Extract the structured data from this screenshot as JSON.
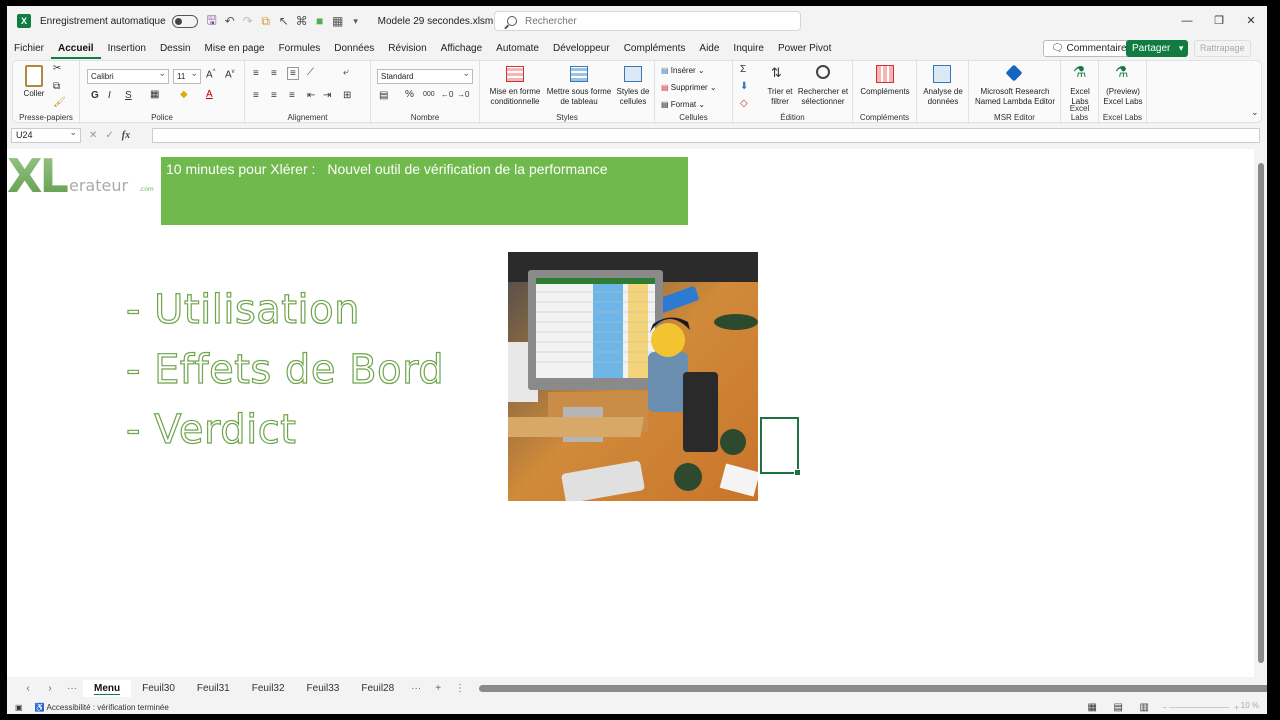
{
  "titlebar": {
    "autosave_label": "Enregistrement automatique",
    "doc_title": "Modele 29 secondes.xlsm  -  E...",
    "search_placeholder": "Rechercher"
  },
  "menu": {
    "items": [
      "Fichier",
      "Accueil",
      "Insertion",
      "Dessin",
      "Mise en page",
      "Formules",
      "Données",
      "Révision",
      "Affichage",
      "Automate",
      "Développeur",
      "Compléments",
      "Aide",
      "Inquire",
      "Power Pivot"
    ],
    "active": "Accueil",
    "comments": "Commentaires",
    "share": "Partager",
    "catchup": "Rattrapage"
  },
  "ribbon": {
    "clipboard": {
      "label": "Presse-papiers",
      "paste": "Coller"
    },
    "font": {
      "label": "Police",
      "font_name": "Calibri",
      "font_size": "11",
      "bold": "G",
      "italic": "I",
      "underline": "S"
    },
    "alignment": {
      "label": "Alignement"
    },
    "number": {
      "label": "Nombre",
      "format": "Standard",
      "percent": "%"
    },
    "styles": {
      "label": "Styles",
      "cond_format": "Mise en forme conditionnelle",
      "table_format": "Mettre sous forme de tableau",
      "cell_styles": "Styles de cellules"
    },
    "cells": {
      "label": "Cellules",
      "insert": "Insérer",
      "delete": "Supprimer",
      "format": "Format"
    },
    "editing": {
      "label": "Édition",
      "sort": "Trier et filtrer",
      "find": "Rechercher et sélectionner"
    },
    "addins": {
      "label": "Compléments",
      "addins": "Compléments",
      "analyze": "Analyse de données"
    },
    "msr": {
      "label": "MSR Editor",
      "lambda": "Microsoft Research Named Lambda Editor"
    },
    "labs": {
      "label": "Excel Labs",
      "button": "Excel Labs"
    },
    "labs_preview": {
      "label": "Excel Labs",
      "button": "(Preview) Excel Labs"
    }
  },
  "formula_bar": {
    "name_box": "U24",
    "fx": "fx",
    "formula": ""
  },
  "sheet": {
    "brand": {
      "xl": "XL",
      "rest": "erateur",
      "suffix": ".com"
    },
    "banner": {
      "part1": "10 minutes pour Xlérer :",
      "part2": "Nouvel outil de vérification de la performance"
    },
    "bullets": [
      "- Utilisation",
      "- Effets de Bord",
      "- Verdict"
    ]
  },
  "tabs": {
    "items": [
      "Menu",
      "Feuil30",
      "Feuil31",
      "Feuil32",
      "Feuil33",
      "Feuil28"
    ],
    "active": "Menu"
  },
  "status": {
    "accessibility": "Accessibilité : vérification terminée",
    "zoom": "10 %"
  },
  "colors": {
    "excel_green": "#107c41",
    "banner_green": "#70b94c",
    "outline_green": "#6ea54c"
  }
}
